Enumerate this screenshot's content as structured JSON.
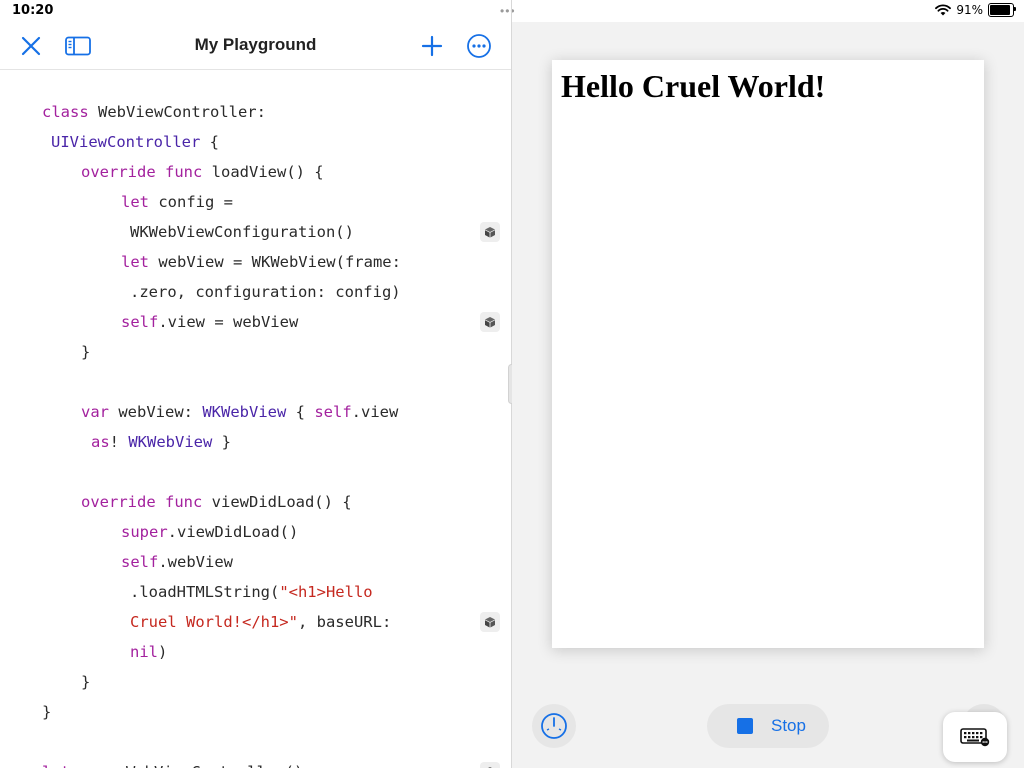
{
  "status_bar": {
    "time": "10:20",
    "battery_percent": "91%",
    "battery_level": 0.91
  },
  "navbar": {
    "title": "My Playground"
  },
  "icons": {
    "close": "close-icon",
    "sidebar": "sidebar-toggle-icon",
    "add": "plus-icon",
    "more": "ellipsis-circle-icon",
    "result": "cube-icon",
    "meter": "gauge-icon",
    "stop": "stop-square-icon",
    "keyboard": "keyboard-icon"
  },
  "colors": {
    "accent": "#1670e6",
    "keyword": "#a3219e",
    "type": "#4a25a8",
    "string": "#c5281f",
    "text": "#2a2a2a"
  },
  "code": {
    "lines": [
      {
        "indent": 42,
        "tokens": [
          {
            "t": "class",
            "k": "kw"
          },
          {
            "t": " WebViewController:"
          }
        ]
      },
      {
        "indent": 51,
        "tokens": [
          {
            "t": "UIViewController",
            "k": "ty"
          },
          {
            "t": " {"
          }
        ]
      },
      {
        "indent": 81,
        "tokens": [
          {
            "t": "override",
            "k": "kw"
          },
          {
            "t": " "
          },
          {
            "t": "func",
            "k": "kw"
          },
          {
            "t": " loadView() {"
          }
        ]
      },
      {
        "indent": 121,
        "tokens": [
          {
            "t": "let",
            "k": "kw"
          },
          {
            "t": " config ="
          }
        ]
      },
      {
        "indent": 130,
        "tokens": [
          {
            "t": "WKWebViewConfiguration()"
          }
        ]
      },
      {
        "indent": 121,
        "tokens": [
          {
            "t": "let",
            "k": "kw"
          },
          {
            "t": " webView = WKWebView(frame:"
          }
        ]
      },
      {
        "indent": 130,
        "tokens": [
          {
            "t": ".zero, configuration: config)"
          }
        ]
      },
      {
        "indent": 121,
        "tokens": [
          {
            "t": "self",
            "k": "kw"
          },
          {
            "t": ".view = webView"
          }
        ]
      },
      {
        "indent": 81,
        "tokens": [
          {
            "t": "}"
          }
        ]
      },
      {
        "indent": 0,
        "tokens": []
      },
      {
        "indent": 81,
        "tokens": [
          {
            "t": "var",
            "k": "kw"
          },
          {
            "t": " webView: "
          },
          {
            "t": "WKWebView",
            "k": "ty"
          },
          {
            "t": " { "
          },
          {
            "t": "self",
            "k": "kw"
          },
          {
            "t": ".view"
          }
        ]
      },
      {
        "indent": 91,
        "tokens": [
          {
            "t": "as",
            "k": "kw"
          },
          {
            "t": "! "
          },
          {
            "t": "WKWebView",
            "k": "ty"
          },
          {
            "t": " }"
          }
        ]
      },
      {
        "indent": 0,
        "tokens": []
      },
      {
        "indent": 81,
        "tokens": [
          {
            "t": "override",
            "k": "kw"
          },
          {
            "t": " "
          },
          {
            "t": "func",
            "k": "kw"
          },
          {
            "t": " viewDidLoad() {"
          }
        ]
      },
      {
        "indent": 121,
        "tokens": [
          {
            "t": "super",
            "k": "kw"
          },
          {
            "t": ".viewDidLoad()"
          }
        ]
      },
      {
        "indent": 121,
        "tokens": [
          {
            "t": "self",
            "k": "kw"
          },
          {
            "t": ".webView"
          }
        ]
      },
      {
        "indent": 130,
        "tokens": [
          {
            "t": ".loadHTMLString("
          },
          {
            "t": "\"<h1>Hello",
            "k": "str"
          }
        ]
      },
      {
        "indent": 130,
        "tokens": [
          {
            "t": "Cruel World!</h1>\"",
            "k": "str"
          },
          {
            "t": ", baseURL:"
          }
        ]
      },
      {
        "indent": 130,
        "tokens": [
          {
            "t": "nil",
            "k": "kw"
          },
          {
            "t": ")"
          }
        ]
      },
      {
        "indent": 81,
        "tokens": [
          {
            "t": "}"
          }
        ]
      },
      {
        "indent": 42,
        "tokens": [
          {
            "t": "}"
          }
        ]
      },
      {
        "indent": 0,
        "tokens": []
      },
      {
        "indent": 42,
        "tokens": [
          {
            "t": "let",
            "k": "kw"
          },
          {
            "t": " vc = WebViewController()"
          }
        ]
      }
    ],
    "result_markers": [
      4,
      7,
      17,
      22
    ]
  },
  "live_view": {
    "heading": "Hello Cruel World!"
  },
  "controls": {
    "stop_label": "Stop"
  }
}
